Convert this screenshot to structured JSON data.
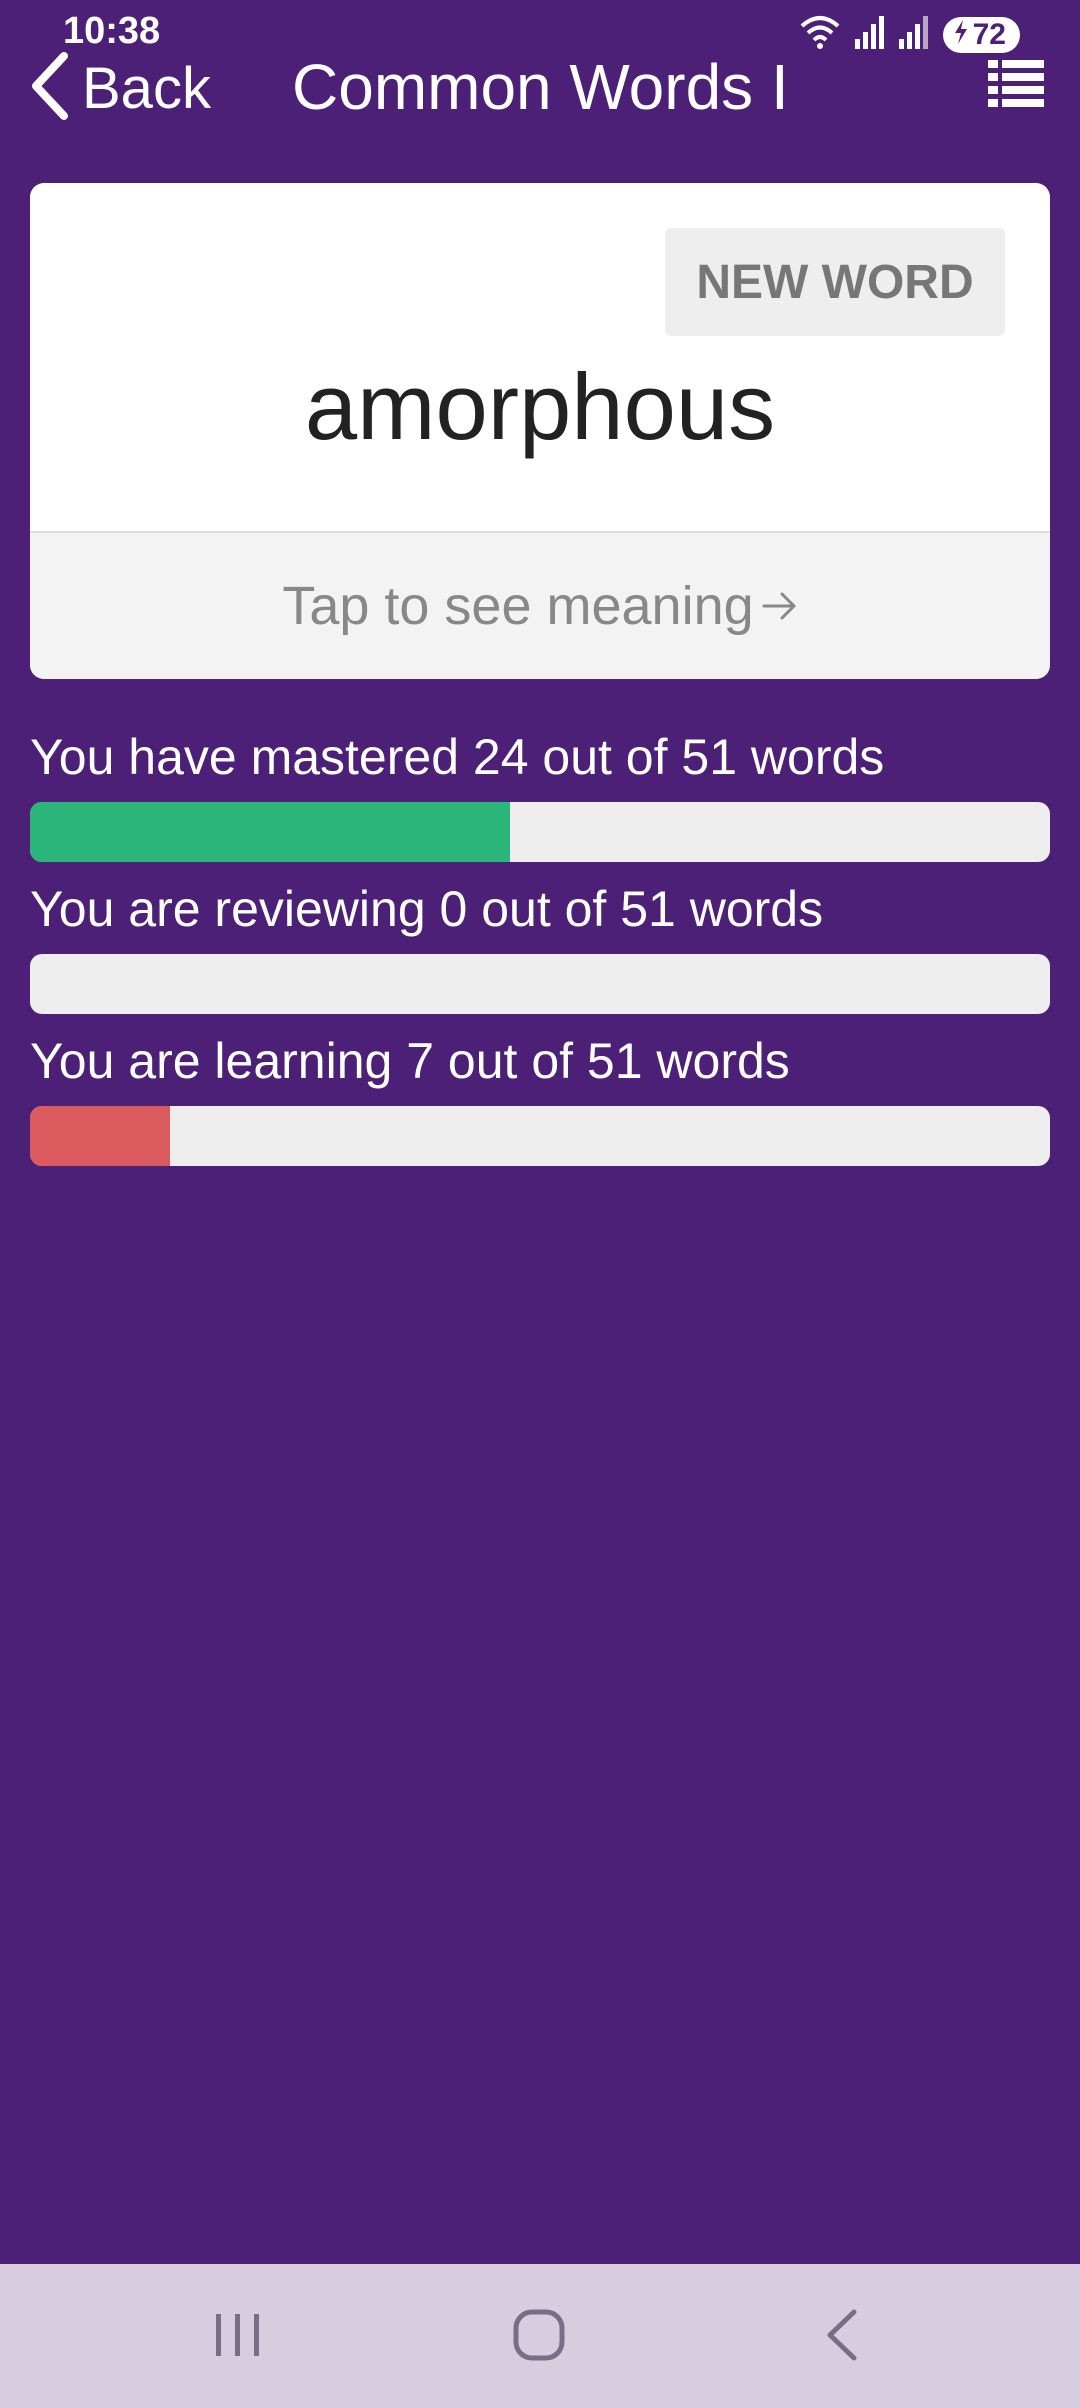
{
  "status_bar": {
    "time": "10:38",
    "battery": "72"
  },
  "header": {
    "back_label": "Back",
    "title": "Common Words I"
  },
  "card": {
    "new_word_label": "NEW WORD",
    "word": "amorphous",
    "meaning_prompt": "Tap to see meaning"
  },
  "progress": [
    {
      "label": "You have mastered 24 out of 51 words",
      "count": 24,
      "total": 51,
      "color": "#2bb57b"
    },
    {
      "label": "You are reviewing 0 out of 51 words",
      "count": 0,
      "total": 51,
      "color": "#f0b400"
    },
    {
      "label": "You are learning 7 out of 51 words",
      "count": 7,
      "total": 51,
      "color": "#da5a5d"
    }
  ],
  "colors": {
    "background": "#4c2076",
    "nav_bar": "#d8cde0"
  }
}
